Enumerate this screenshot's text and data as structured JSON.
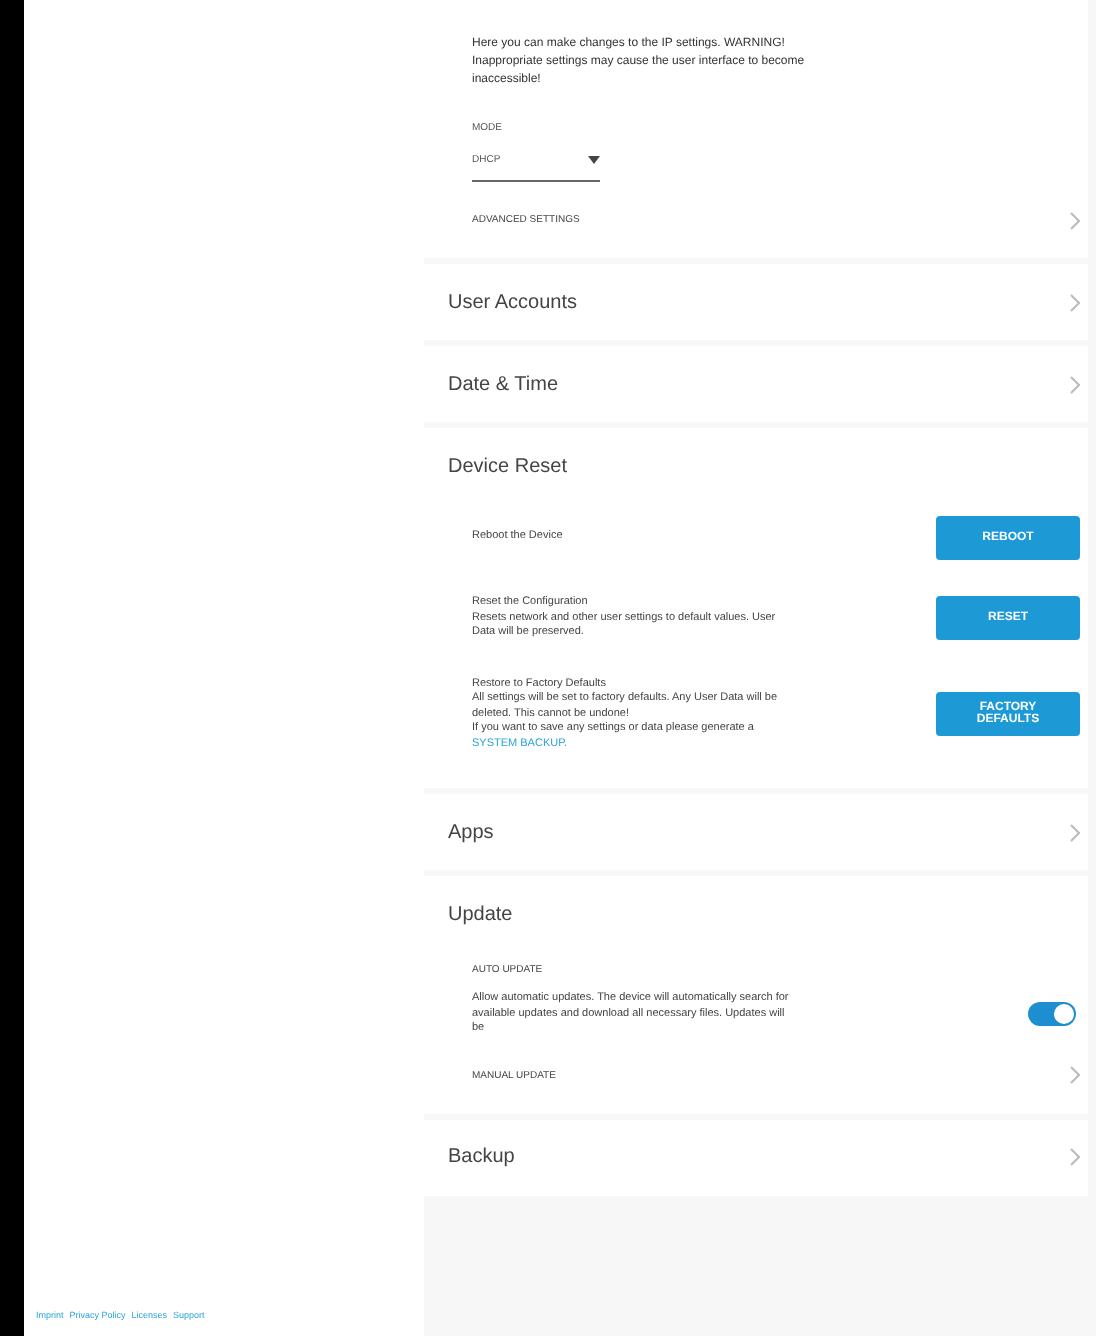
{
  "ip_settings": {
    "description": "Here you can make changes to the IP settings. WARNING! Inappropriate settings may cause the user interface to become inaccessible!",
    "mode_label": "MODE",
    "mode_value": "DHCP",
    "advanced_settings": "ADVANCED SETTINGS"
  },
  "sections": [
    {
      "title": "User Accounts",
      "kind": "link"
    },
    {
      "title": "Date & Time",
      "kind": "link"
    },
    {
      "title": "Device Reset",
      "kind": "reset",
      "items": [
        {
          "text": "Reboot the Device",
          "button": "REBOOT"
        },
        {
          "text": "Reset the Configuration\nResets network and other user settings to default values. User Data will be preserved.",
          "button": "RESET"
        },
        {
          "text": "Restore to Factory Defaults\nAll settings will be set to factory defaults. Any User Data will be deleted. This cannot be undone!\nIf you want to save any settings or data please generate a ",
          "link": "SYSTEM BACKUP.",
          "button": "FACTORY DEFAULTS"
        }
      ]
    },
    {
      "title": "Apps",
      "kind": "link"
    },
    {
      "title": "Update",
      "kind": "update",
      "auto_label": "AUTO UPDATE",
      "auto_text": "Allow automatic updates. The device will automatically search for available updates and download all necessary files. Updates will be",
      "auto_on": true,
      "manual_label": "MANUAL UPDATE"
    },
    {
      "title": "Backup",
      "kind": "link"
    }
  ],
  "footer": [
    "Imprint",
    "Privacy Policy",
    "Licenses",
    "Support"
  ]
}
